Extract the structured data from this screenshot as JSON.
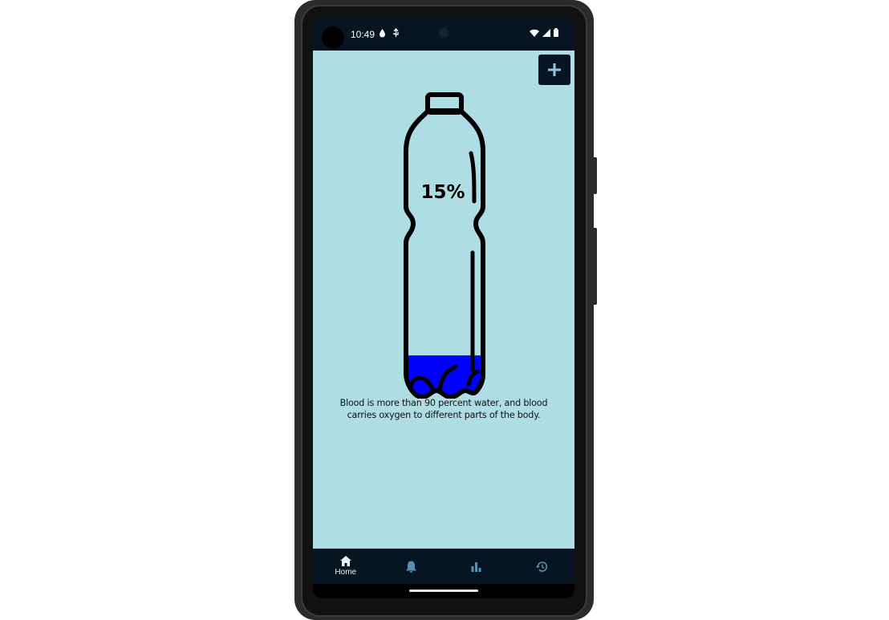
{
  "status_bar": {
    "time": "10:49"
  },
  "toolbar": {
    "add_label": "+"
  },
  "hydration": {
    "percent_label": "15%",
    "fill_fraction": 0.15,
    "water_color": "#0000ff"
  },
  "fact": {
    "text": "Blood is more than 90 percent water, and blood carries oxygen to different parts of the body."
  },
  "nav": {
    "items": [
      {
        "icon": "home-icon",
        "label": "Home",
        "active": true
      },
      {
        "icon": "bell-icon",
        "label": "",
        "active": false
      },
      {
        "icon": "bar-chart-icon",
        "label": "",
        "active": false
      },
      {
        "icon": "history-icon",
        "label": "",
        "active": false
      }
    ]
  },
  "colors": {
    "background": "#aedde4",
    "bar": "#071523",
    "nav_inactive": "#5b8fb0",
    "accent_light": "#8fc4e6"
  }
}
